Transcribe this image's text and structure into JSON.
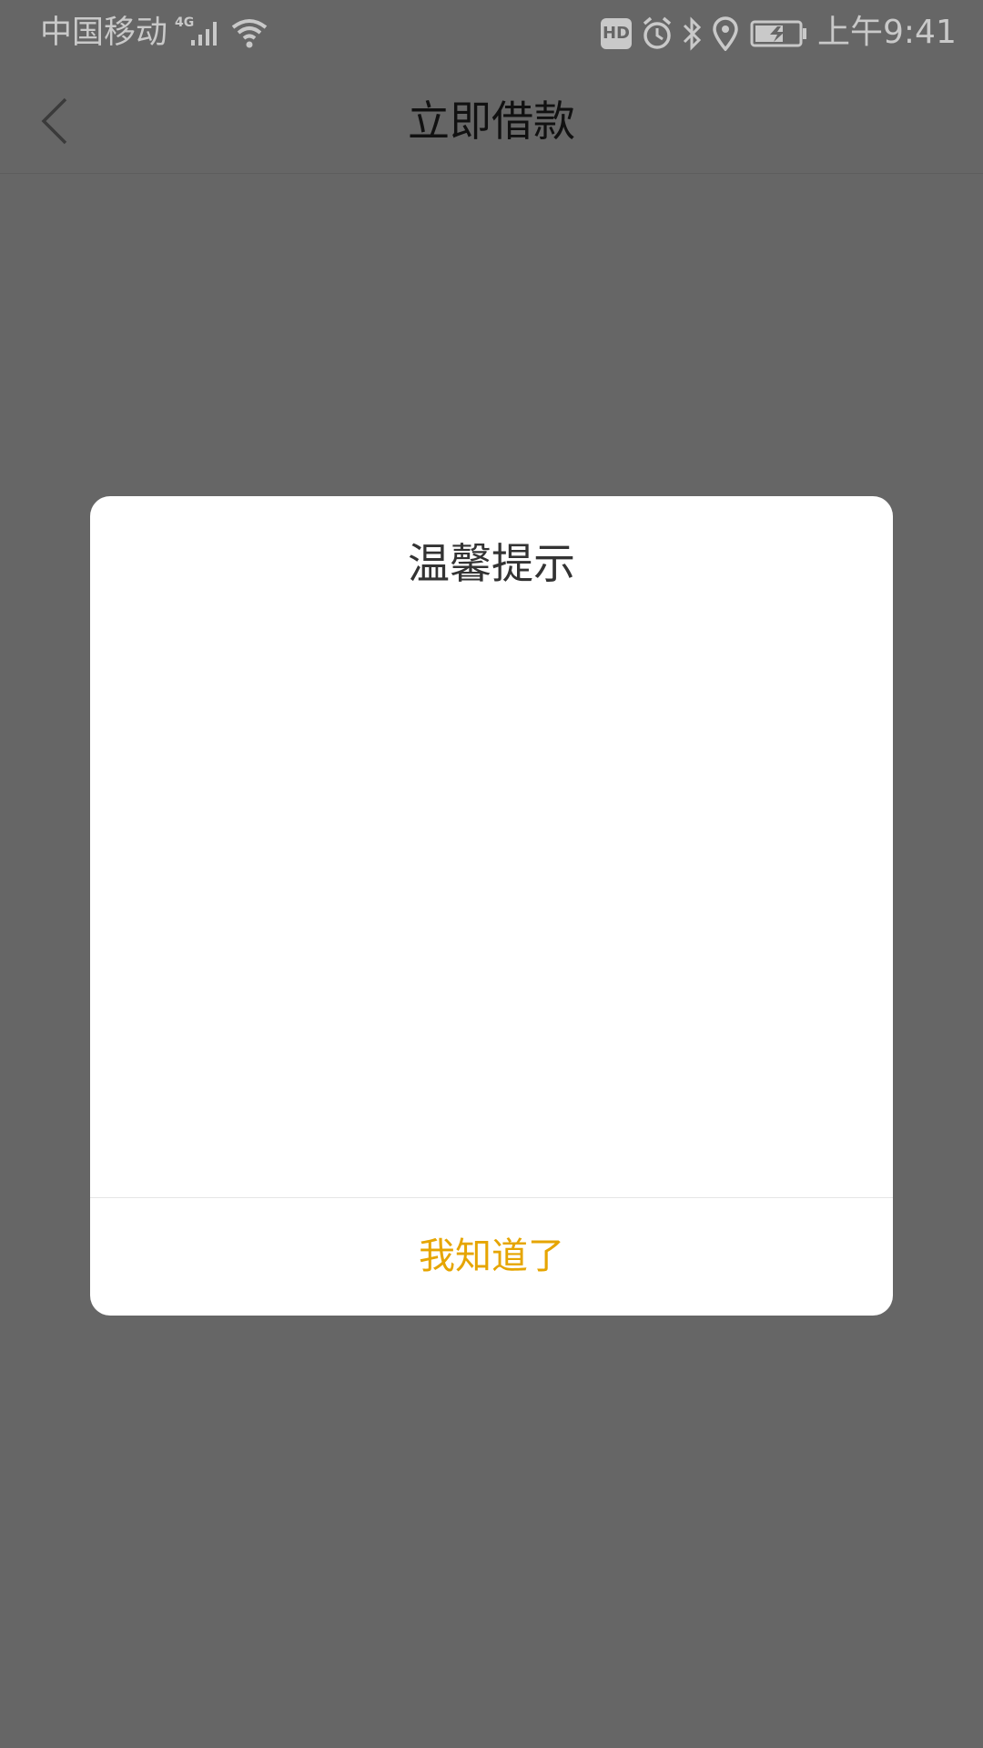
{
  "status_bar": {
    "carrier": "中国移动",
    "network_type": "4G",
    "hd_badge": "HD",
    "time": "上午9:41",
    "icons": [
      "signal-icon",
      "wifi-icon",
      "hd-icon",
      "alarm-icon",
      "bluetooth-icon",
      "location-icon",
      "battery-charging-icon"
    ]
  },
  "nav": {
    "title": "立即借款",
    "back_icon": "chevron-left-icon"
  },
  "dialog": {
    "title": "温馨提示",
    "confirm_label": "我知道了"
  },
  "colors": {
    "overlay_background": "#666666",
    "dialog_background": "#ffffff",
    "accent": "#e6a500",
    "title_text": "#333333"
  }
}
